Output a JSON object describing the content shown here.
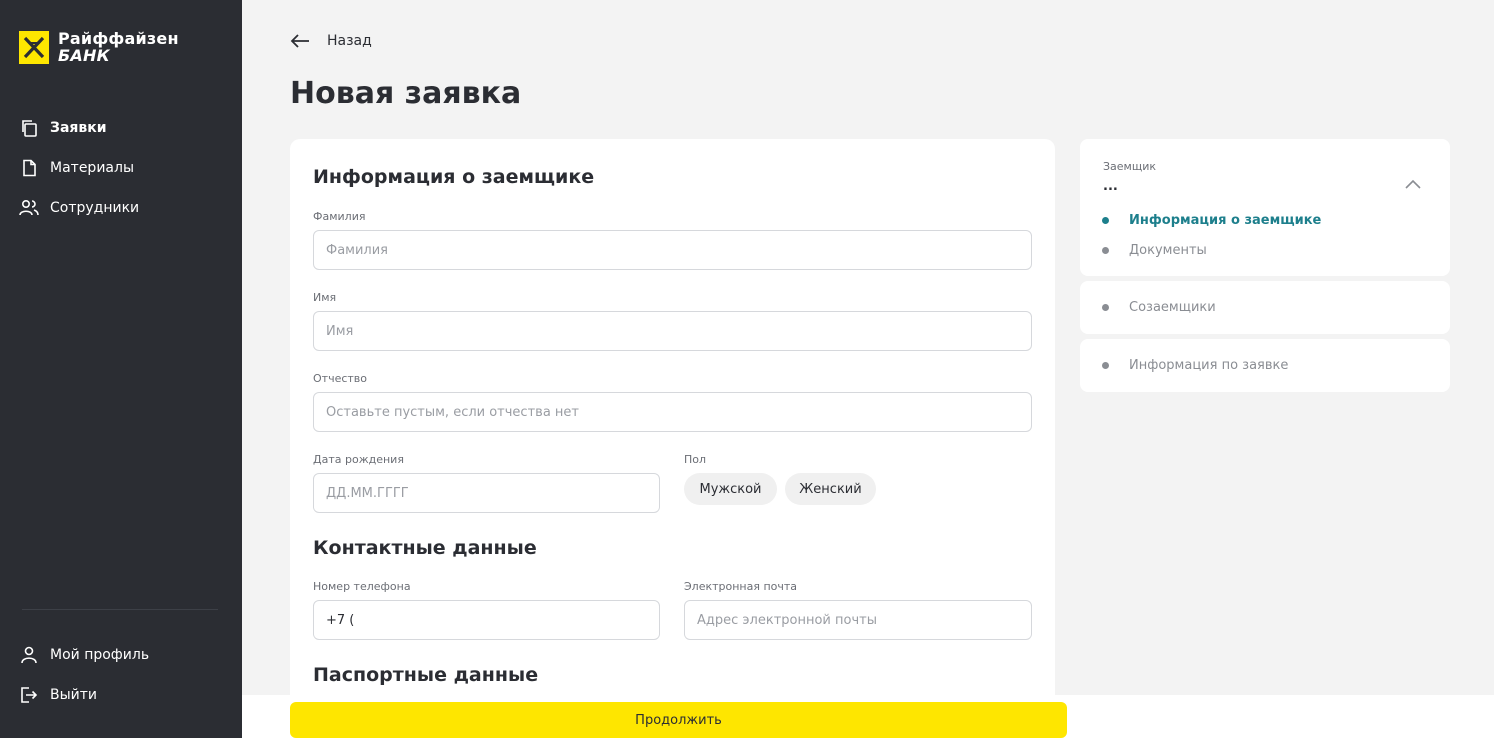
{
  "brand": {
    "line1": "Райффайзен",
    "line2": "БАНК",
    "accent": "#fee600"
  },
  "sidebar": {
    "items": [
      {
        "label": "Заявки",
        "icon": "copy-icon"
      },
      {
        "label": "Материалы",
        "icon": "document-icon"
      },
      {
        "label": "Сотрудники",
        "icon": "users-icon"
      }
    ],
    "bottom": [
      {
        "label": "Мой профиль",
        "icon": "user-icon"
      },
      {
        "label": "Выйти",
        "icon": "logout-icon"
      }
    ]
  },
  "header": {
    "back_label": "Назад",
    "title": "Новая заявка"
  },
  "form": {
    "section_borrower": "Информация о заемщике",
    "last_name": {
      "label": "Фамилия",
      "placeholder": "Фамилия"
    },
    "first_name": {
      "label": "Имя",
      "placeholder": "Имя"
    },
    "middle_name": {
      "label": "Отчество",
      "placeholder": "Оставьте пустым, если отчества нет"
    },
    "birth_date": {
      "label": "Дата рождения",
      "placeholder": "ДД.ММ.ГГГГ"
    },
    "gender": {
      "label": "Пол",
      "options": [
        "Мужской",
        "Женский"
      ]
    },
    "section_contacts": "Контактные данные",
    "phone": {
      "label": "Номер телефона",
      "value": "+7 ("
    },
    "email": {
      "label": "Электронная почта",
      "placeholder": "Адрес электронной почты"
    },
    "section_passport": "Паспортные данные"
  },
  "steps": {
    "borrower_label": "Заемщик",
    "borrower_value": "...",
    "sub": [
      "Информация о заемщике",
      "Документы"
    ],
    "co_borrowers": "Созаемщики",
    "application_info": "Информация по заявке",
    "active_color": "#1d7f8c"
  },
  "footer": {
    "continue_label": "Продолжить"
  }
}
